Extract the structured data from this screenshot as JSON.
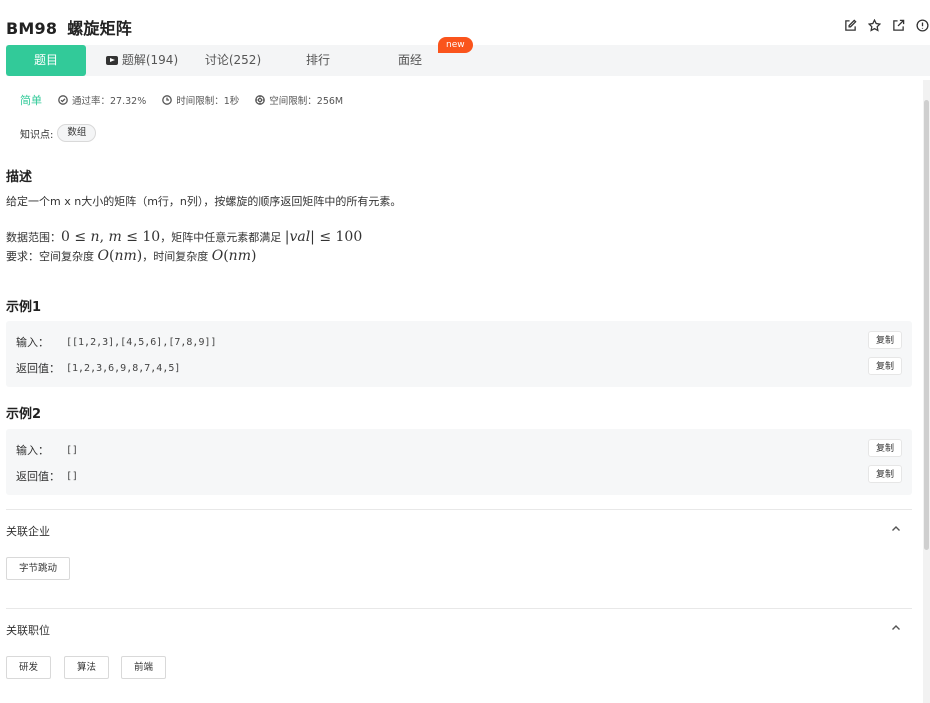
{
  "problem": {
    "id": "BM98",
    "title": "螺旋矩阵"
  },
  "header_icons": [
    "edit-icon",
    "star-icon",
    "share-icon",
    "info-icon"
  ],
  "tabs": {
    "problem": "题目",
    "solutions": "题解(194)",
    "discussion": "讨论(252)",
    "ranking": "排行",
    "interview": "面经",
    "new_badge": "new"
  },
  "meta": {
    "difficulty": "简单",
    "pass_rate": "通过率：27.32%",
    "time_limit": "时间限制：1秒",
    "memory_limit": "空间限制：256M"
  },
  "knowledge": {
    "label": "知识点:",
    "tags": [
      "数组"
    ]
  },
  "description": {
    "heading": "描述",
    "text": "给定一个m x n大小的矩阵（m行，n列），按螺旋的顺序返回矩阵中的所有元素。",
    "range_prefix": "数据范围：",
    "range_suffix": "，矩阵中任意元素都满足",
    "req_prefix": "要求：空间复杂度",
    "req_middle": "，时间复杂度"
  },
  "examples": [
    {
      "heading": "示例1",
      "input_label": "输入：",
      "input": "[[1,2,3],[4,5,6],[7,8,9]]",
      "output_label": "返回值：",
      "output": "[1,2,3,6,9,8,7,4,5]",
      "copy_label": "复制"
    },
    {
      "heading": "示例2",
      "input_label": "输入：",
      "input": "[]",
      "output_label": "返回值：",
      "output": "[]",
      "copy_label": "复制"
    }
  ],
  "related_companies": {
    "title": "关联企业",
    "items": [
      "字节跳动"
    ]
  },
  "related_positions": {
    "title": "关联职位",
    "items": [
      "研发",
      "算法",
      "前端"
    ]
  },
  "colors": {
    "accent": "#32ca99",
    "badge": "#fa541c"
  }
}
